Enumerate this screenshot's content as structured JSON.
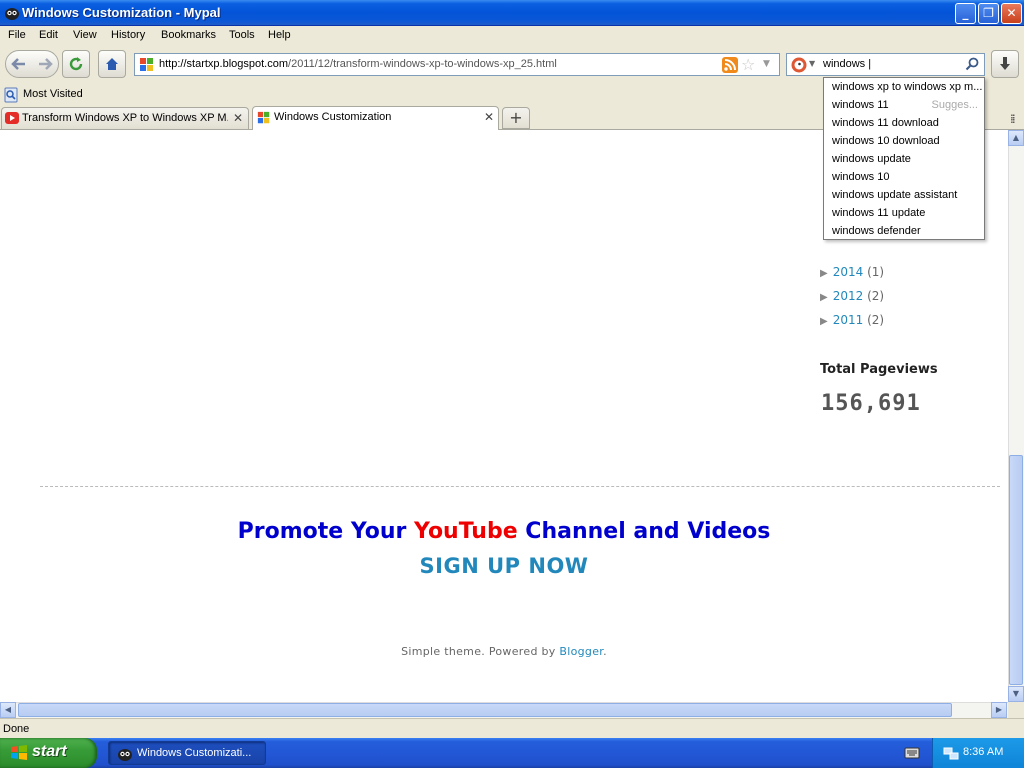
{
  "window": {
    "title": "Windows Customization - Mypal",
    "min_glyph": "_",
    "max_glyph": "❐",
    "close_glyph": "✕"
  },
  "menu": [
    "File",
    "Edit",
    "View",
    "History",
    "Bookmarks",
    "Tools",
    "Help"
  ],
  "nav": {
    "url_host": "http://startxp.blogspot.com",
    "url_path": "/2011/12/transform-windows-xp-to-windows-xp_25.html",
    "search_value": "windows |"
  },
  "bookmarks": {
    "most_visited": "Most Visited"
  },
  "tabs": [
    {
      "label": "Transform Windows XP to Windows XP M...",
      "active": false
    },
    {
      "label": "Windows Customization",
      "active": true
    }
  ],
  "tab_close_glyph": "✕",
  "new_tab_glyph": "+",
  "search_suggestions": {
    "items": [
      "windows xp to windows xp m...",
      "windows 11",
      "windows 11 download",
      "windows 10 download",
      "windows update",
      "windows 10",
      "windows update assistant",
      "windows 11 update",
      "windows defender"
    ],
    "hint": "Sugges..."
  },
  "blog": {
    "archive": [
      {
        "year": "2014",
        "count": "(1)"
      },
      {
        "year": "2012",
        "count": "(2)"
      },
      {
        "year": "2011",
        "count": "(2)"
      }
    ],
    "pageviews_title": "Total Pageviews",
    "pageviews_count": "156,691",
    "promo_part1": "Promote Your ",
    "promo_youtube": "YouTube",
    "promo_part2": " Channel and Videos",
    "signup": "SIGN UP NOW",
    "footer_prefix": "Simple theme. Powered by ",
    "footer_link": "Blogger",
    "footer_suffix": "."
  },
  "status": "Done",
  "taskbar": {
    "start": "start",
    "task_item": "Windows Customizati...",
    "clock": "8:36 AM"
  },
  "colors": {
    "accent_link": "#2288bb",
    "promo_blue": "#0000cc",
    "promo_red": "#ee0000"
  }
}
